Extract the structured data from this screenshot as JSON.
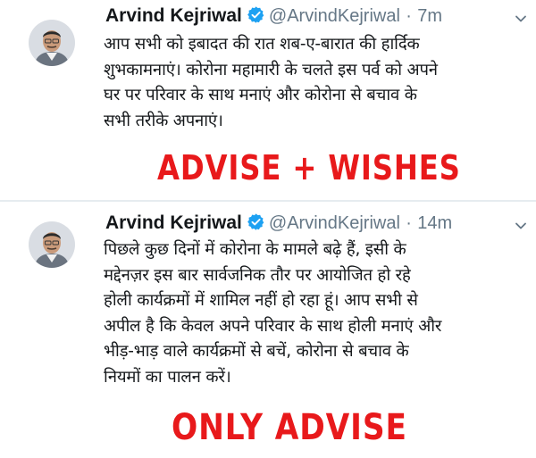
{
  "tweets": [
    {
      "name": "Arvind Kejriwal",
      "handle": "@ArvindKejriwal",
      "separator": "·",
      "time": "7m",
      "lines": [
        "आप सभी को इबादत की रात शब-ए-बारात की हार्दिक",
        "शुभकामनाएं। कोरोना महामारी के चलते इस पर्व को अपने",
        "घर पर परिवार के साथ मनाएं और कोरोना से बचाव के",
        "सभी तरीके अपनाएं।"
      ]
    },
    {
      "name": "Arvind Kejriwal",
      "handle": "@ArvindKejriwal",
      "separator": "·",
      "time": "14m",
      "lines": [
        "पिछले कुछ दिनों में कोरोना के मामले बढ़े हैं, इसी के",
        "मद्देनज़र इस बार सार्वजनिक तौर पर आयोजित हो रहे",
        "होली कार्यक्रमों में शामिल नहीं हो रहा हूं। आप सभी से",
        "अपील है कि केवल अपने परिवार के साथ होली मनाएं और",
        "भीड़-भाड़ वाले कार्यक्रमों से बचें, कोरोना से बचाव के",
        "नियमों का पालन करें।"
      ]
    }
  ],
  "annotations": {
    "first": "ADVISE + WISHES",
    "second": "ONLY ADVISE"
  },
  "icons": {
    "verified": "verified-badge-icon",
    "menu": "chevron-down-icon"
  },
  "colors": {
    "verified": "#1da1f2",
    "annotation": "#e8191b",
    "secondary_text": "#657786",
    "divider": "#e6ecf0"
  }
}
